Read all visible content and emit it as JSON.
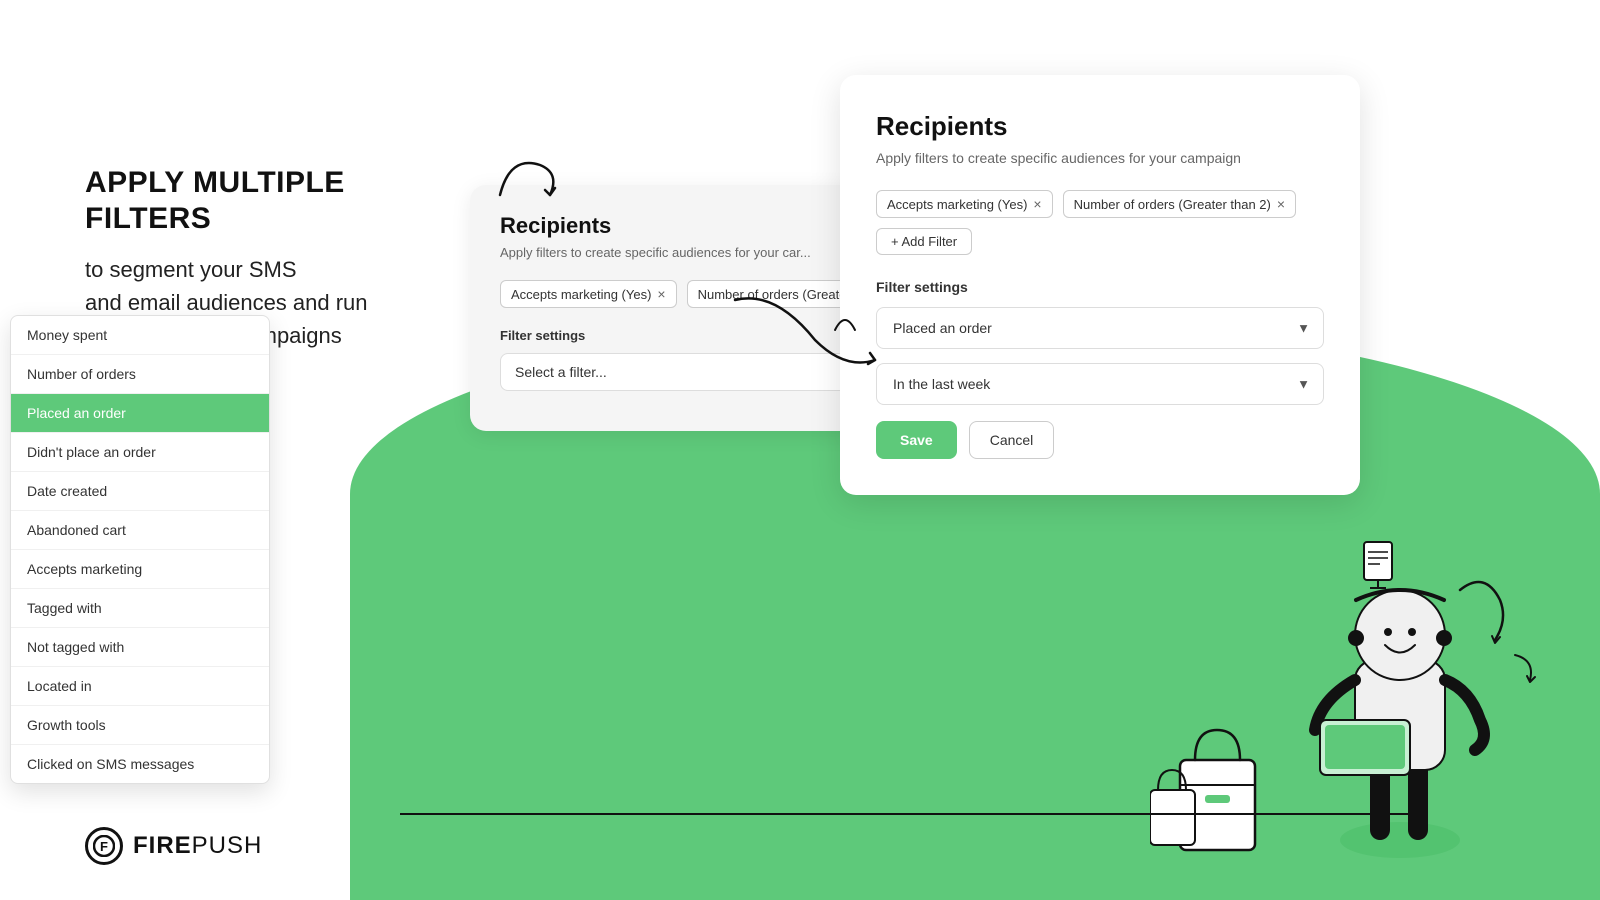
{
  "left": {
    "heading": "APPLY MULTIPLE FILTERS",
    "body_line1": "to segment your SMS",
    "body_line2": "and email audiences and run",
    "body_line3": "more impactful campaigns"
  },
  "logo": {
    "icon_letter": "F",
    "name_bold": "FIRE",
    "name_light": "PUSH"
  },
  "card_back": {
    "title": "Recipients",
    "subtitle": "Apply filters to create specific audiences for your car...",
    "tag1": "Accepts marketing (Yes)",
    "tag2": "Number of orders (Greater...",
    "filter_settings_label": "Filter settings",
    "select_placeholder": "Select a filter..."
  },
  "dropdown": {
    "items": [
      {
        "label": "Money spent",
        "selected": false
      },
      {
        "label": "Number of orders",
        "selected": false
      },
      {
        "label": "Placed an order",
        "selected": true
      },
      {
        "label": "Didn't place an order",
        "selected": false
      },
      {
        "label": "Date created",
        "selected": false
      },
      {
        "label": "Abandoned cart",
        "selected": false
      },
      {
        "label": "Accepts marketing",
        "selected": false
      },
      {
        "label": "Tagged with",
        "selected": false
      },
      {
        "label": "Not tagged with",
        "selected": false
      },
      {
        "label": "Located in",
        "selected": false
      },
      {
        "label": "Growth tools",
        "selected": false
      },
      {
        "label": "Clicked on SMS messages",
        "selected": false
      }
    ]
  },
  "card_right": {
    "title": "Recipients",
    "subtitle": "Apply filters to create specific audiences for your campaign",
    "tag1": "Accepts marketing (Yes)",
    "tag2": "Number of orders (Greater than 2)",
    "add_filter": "+ Add Filter",
    "filter_settings_label": "Filter settings",
    "filter_value": "Placed an order",
    "filter_time": "In the last week",
    "save_label": "Save",
    "cancel_label": "Cancel"
  },
  "colors": {
    "green": "#5ec97a",
    "dark": "#111111",
    "gray": "#666666"
  }
}
